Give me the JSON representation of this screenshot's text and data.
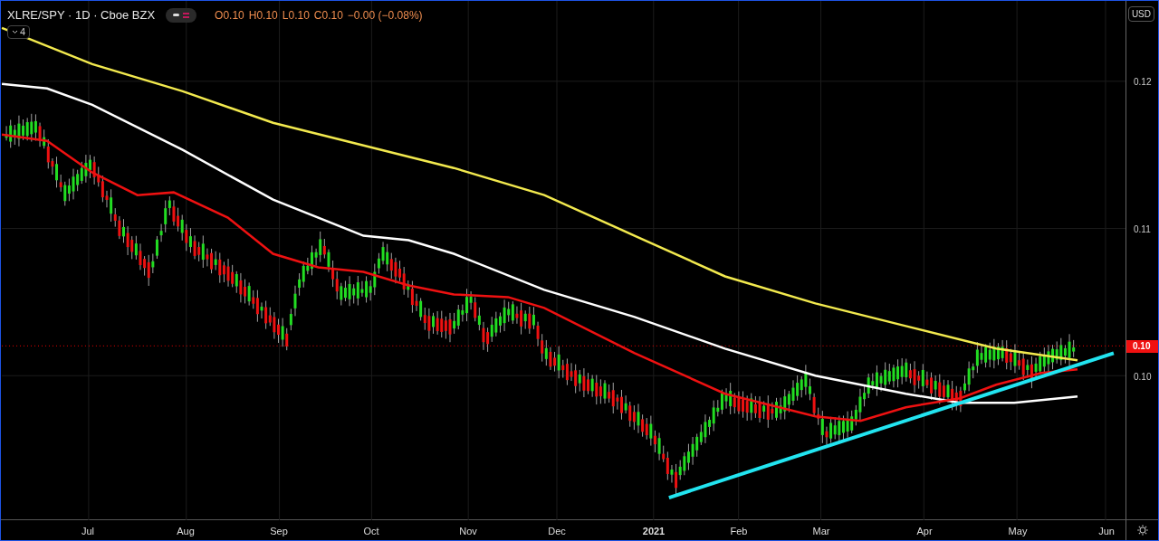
{
  "symbol_header": {
    "title": "XLRE/SPY · 1D · Cboe BZX",
    "ohlc": [
      "O0.10",
      "H0.10",
      "L0.10",
      "C0.10"
    ],
    "change": "−0.00 (−0.08%)"
  },
  "indicators_toggle": {
    "count": "4"
  },
  "price_axis": {
    "currency": "USD",
    "labels": [
      "0.12",
      "0.11",
      "0.10"
    ],
    "last_price": "0.10"
  },
  "time_axis": {
    "labels": [
      "Jul",
      "Aug",
      "Sep",
      "Oct",
      "Nov",
      "Dec",
      "2021",
      "Feb",
      "Mar",
      "Apr",
      "May",
      "Jun"
    ]
  }
}
